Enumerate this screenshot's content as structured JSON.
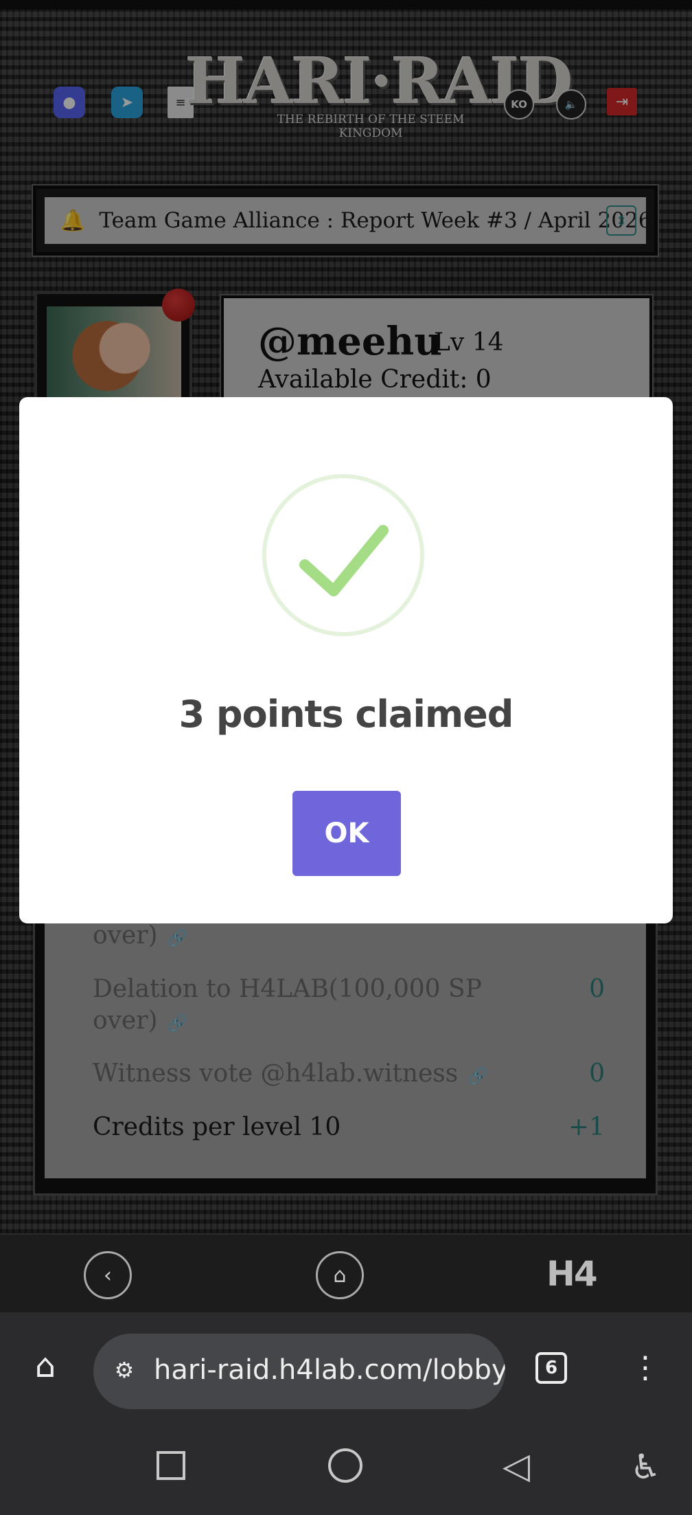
{
  "header": {
    "logo_main": "HARI·RAID",
    "logo_sub": "THE REBIRTH OF THE STEEM KINGDOM",
    "icons": [
      "discord-icon",
      "telegram-icon",
      "document-icon",
      "language-icon",
      "sound-icon",
      "logout-icon"
    ],
    "language_label": "KO"
  },
  "notice": {
    "text": "Team Game Alliance : Report Week #3 / April 2026"
  },
  "profile": {
    "username": "@meehu",
    "level": "Lv 14",
    "available_credit": "Available Credit: 0"
  },
  "credits": {
    "rows": [
      {
        "label": "over)",
        "value": ""
      },
      {
        "label": "Delation to H4LAB(100,000 SP over)",
        "value": "0"
      },
      {
        "label": "Witness vote @h4lab.witness",
        "value": "0"
      },
      {
        "label": "Credits per level 10",
        "value": "+1"
      }
    ]
  },
  "modal": {
    "title": "3 points claimed",
    "ok_label": "OK",
    "colors": {
      "success": "#a5dc86",
      "button": "#7066db"
    }
  },
  "game_nav": {
    "logo": "H4"
  },
  "browser": {
    "url": "hari-raid.h4lab.com/lobby",
    "tab_count": "6"
  }
}
